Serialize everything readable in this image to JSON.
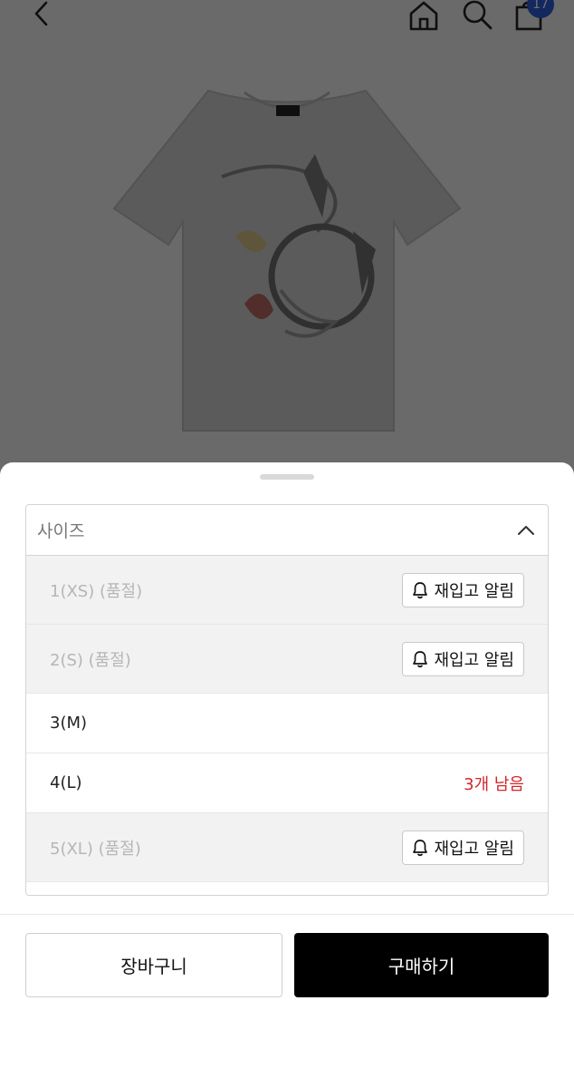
{
  "header": {
    "back_icon": "chevron-left-icon",
    "home_icon": "home-icon",
    "search_icon": "search-icon",
    "bag_icon": "shopping-bag-icon",
    "bag_count": "17"
  },
  "product": {
    "image_description": "gray-tshirt-graphic-print"
  },
  "size_select": {
    "placeholder": "사이즈",
    "options": [
      {
        "label": "1(XS) (품절)",
        "status": "soldout",
        "action": "재입고 알림"
      },
      {
        "label": "2(S) (품절)",
        "status": "soldout",
        "action": "재입고 알림"
      },
      {
        "label": "3(M)",
        "status": "available"
      },
      {
        "label": "4(L)",
        "status": "low-stock",
        "stock_note": "3개 남음"
      },
      {
        "label": "5(XL) (품절)",
        "status": "soldout",
        "action": "재입고 알림"
      }
    ]
  },
  "actions": {
    "cart_label": "장바구니",
    "buy_label": "구매하기"
  },
  "colors": {
    "accent_badge": "#2a5bd7",
    "low_stock": "#d2262c",
    "buy_button": "#000000"
  }
}
